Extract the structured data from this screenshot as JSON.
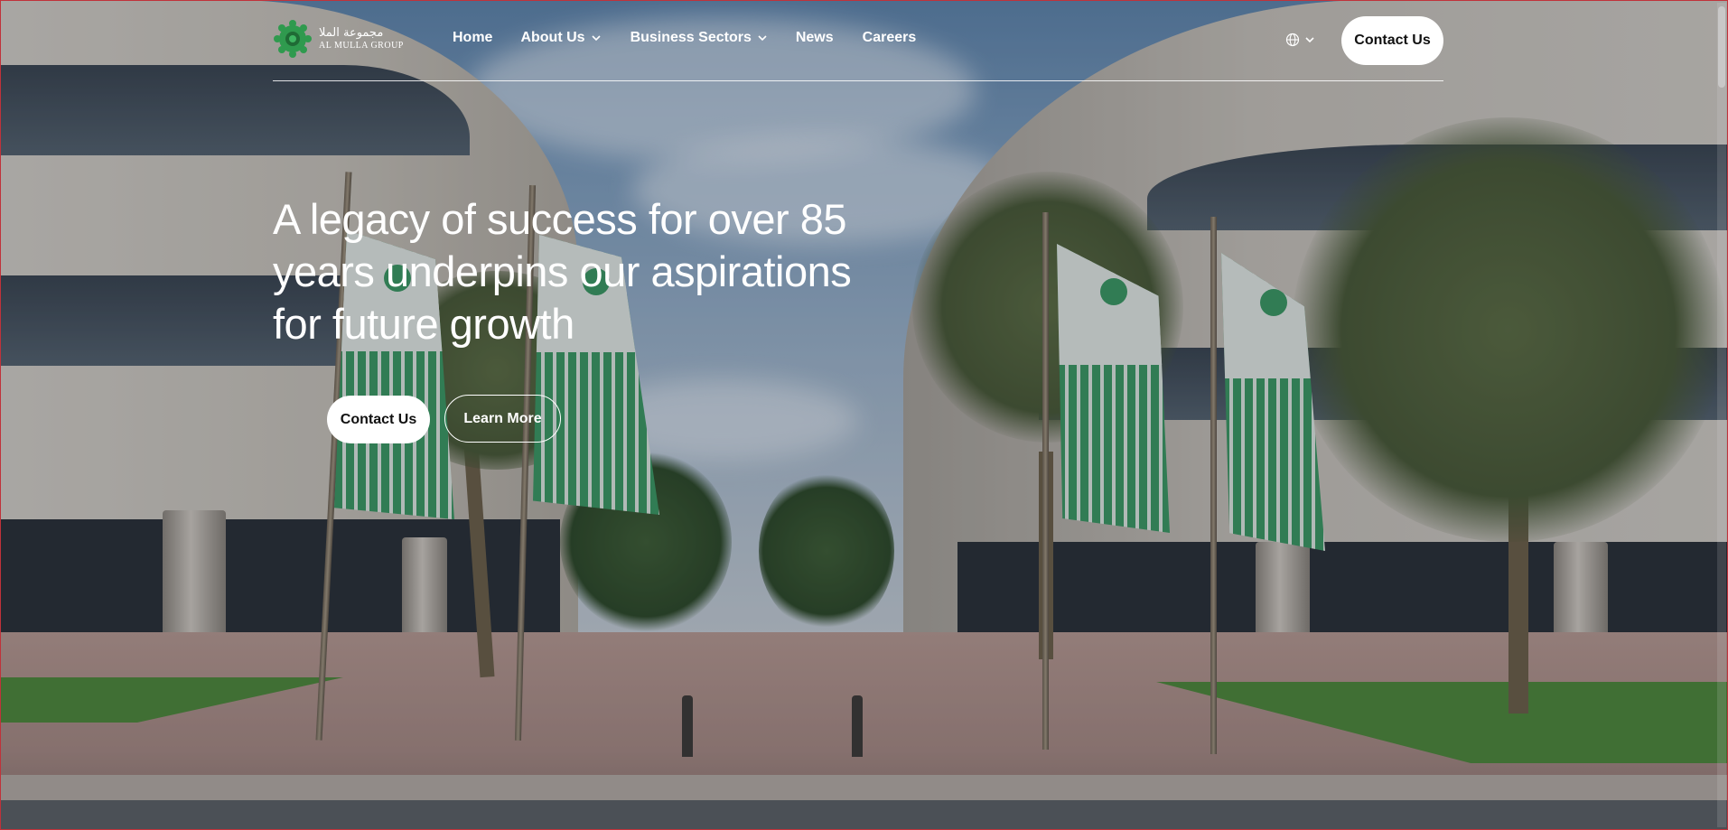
{
  "header": {
    "logo": {
      "arabic_text": "مجموعة الملا",
      "english_text": "AL MULLA GROUP",
      "brand_color": "#2f9a4e"
    },
    "nav": [
      {
        "label": "Home",
        "has_dropdown": false
      },
      {
        "label": "About Us",
        "has_dropdown": true
      },
      {
        "label": "Business Sectors",
        "has_dropdown": true
      },
      {
        "label": "News",
        "has_dropdown": false
      },
      {
        "label": "Careers",
        "has_dropdown": false
      }
    ],
    "language_icon": "globe-icon",
    "contact_label": "Contact Us"
  },
  "hero": {
    "title_lines": [
      "A legacy of success for over 85",
      "years underpins our aspirations",
      "for future growth"
    ],
    "primary_button": "Contact Us",
    "secondary_button": "Learn More"
  },
  "colors": {
    "button_background": "#ffffff",
    "text_on_hero": "#ffffff",
    "flag_green": "#3c9a63"
  }
}
